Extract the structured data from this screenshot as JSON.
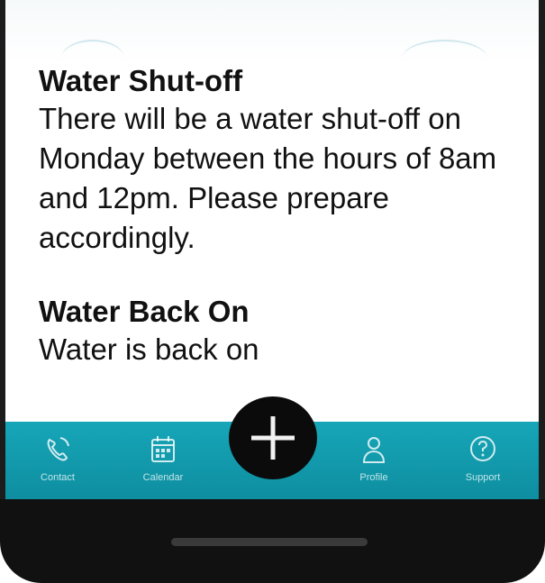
{
  "messages": [
    {
      "title": "Water Shut-off",
      "body": "There will be a water shut-off on Monday between the hours of 8am and 12pm. Please prepare accordingly."
    },
    {
      "title": "Water Back On",
      "body": "Water is back on"
    }
  ],
  "nav": {
    "contact_label": "Contact",
    "calendar_label": "Calendar",
    "profile_label": "Profile",
    "support_label": "Support",
    "add_icon": "plus-icon"
  },
  "colors": {
    "nav_bg": "#129cae",
    "fab_bg": "#0b0b0b",
    "text": "#111111"
  }
}
